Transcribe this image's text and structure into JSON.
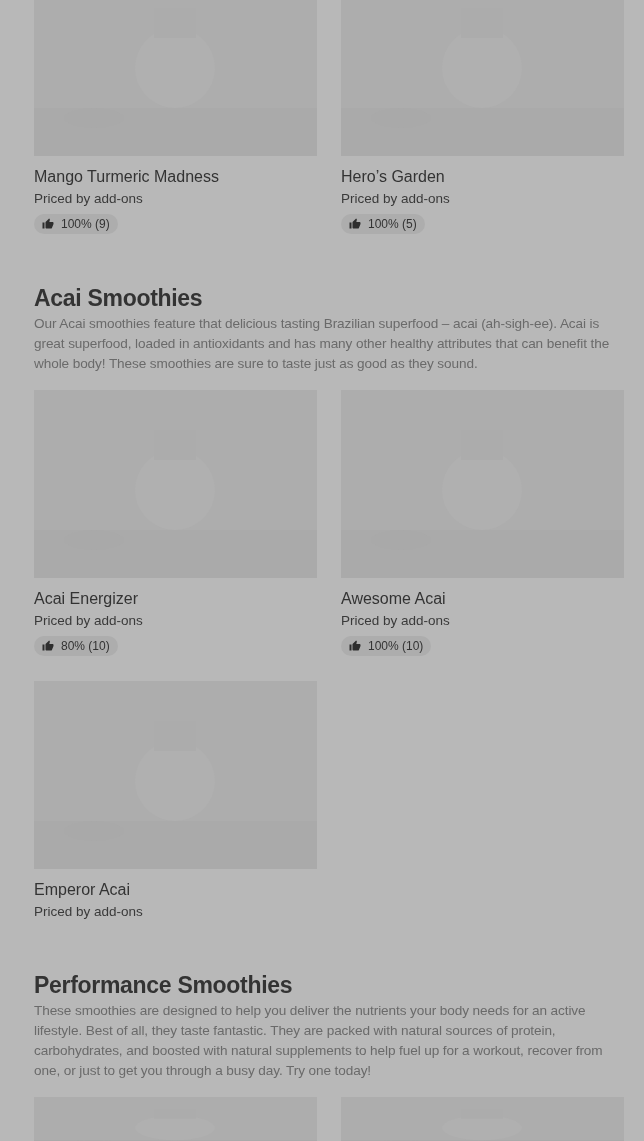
{
  "sections": [
    {
      "items": [
        {
          "kind": "item",
          "name": "Mango Turmeric Madness",
          "price": "Priced by add-ons",
          "rating": "100% (9)"
        },
        {
          "kind": "item",
          "name": "Hero’s Garden",
          "price": "Priced by add-ons",
          "rating": "100% (5)"
        }
      ]
    },
    {
      "title": "Acai Smoothies",
      "description": "Our Acai smoothies feature that delicious tasting Brazilian superfood – acai (ah-sigh-ee). Acai is great superfood, loaded in antioxidants and has many other healthy attributes that can benefit the whole body! These smoothies are sure to taste just as good as they sound.",
      "items": [
        {
          "kind": "item",
          "name": "Acai Energizer",
          "price": "Priced by add-ons",
          "rating": "80% (10)"
        },
        {
          "kind": "item",
          "name": "Awesome Acai",
          "price": "Priced by add-ons",
          "rating": "100% (10)"
        },
        {
          "kind": "item",
          "name": "Emperor Acai",
          "price": "Priced by add-ons"
        }
      ]
    },
    {
      "title": "Performance Smoothies",
      "description": "These smoothies are designed to help you deliver the nutrients your body needs for an active lifestyle. Best of all, they taste fantastic. They are packed with natural sources of protein, carbohydrates, and boosted with natural supplements to help fuel up for a workout, recover from one, or just to get you through a busy day. Try one today!"
    }
  ]
}
